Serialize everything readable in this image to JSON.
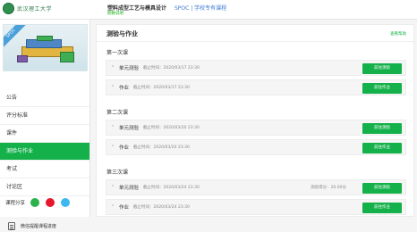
{
  "header": {
    "school_name": "武汉理工大学",
    "course_title": "塑料成型工艺与模具设计",
    "course_link": "SPOC | 学校专有课程",
    "course_sub": "期数说明"
  },
  "sidebar": {
    "cover_badge": "SPOC",
    "items": [
      {
        "label": "公告"
      },
      {
        "label": "评分标准"
      },
      {
        "label": "课件"
      },
      {
        "label": "测验与作业"
      },
      {
        "label": "考试"
      },
      {
        "label": "讨论区"
      }
    ],
    "share_label": "课程分享",
    "progress_label": "微信提醒课程进度"
  },
  "main": {
    "title": "测验与作业",
    "help_link": "查看帮助",
    "lessons": [
      {
        "title": "第一次课",
        "tasks": [
          {
            "name": "单元测验",
            "due": "截止时间：2020/03/17 23:30",
            "score": "",
            "button": "前往测验"
          },
          {
            "name": "作业",
            "due": "截止时间：2020/03/17 23:30",
            "score": "",
            "button": "前往作业"
          }
        ]
      },
      {
        "title": "第二次课",
        "tasks": [
          {
            "name": "单元测验",
            "due": "截止时间：2020/03/20 23:30",
            "score": "",
            "button": "前往测验"
          },
          {
            "name": "作业",
            "due": "截止时间：2020/03/20 23:30",
            "score": "",
            "button": "前往作业"
          }
        ]
      },
      {
        "title": "第三次课",
        "tasks": [
          {
            "name": "单元测验",
            "due": "截止时间：2020/03/24 23:30",
            "score": "测验得分：20.00分",
            "button": "前往测验"
          },
          {
            "name": "作业",
            "due": "截止时间：2020/03/24 23:30",
            "score": "",
            "button": "前往作业"
          }
        ]
      }
    ]
  },
  "colors": {
    "accent": "#14b14a",
    "link": "#3a7bd5"
  }
}
